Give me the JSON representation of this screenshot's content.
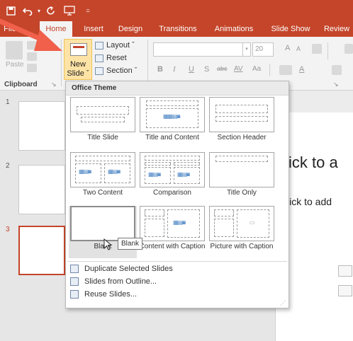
{
  "qat": {
    "save_icon": "save-icon",
    "undo_icon": "undo-icon",
    "redo_icon": "redo-icon",
    "present_icon": "present-icon",
    "more_icon": "qat-more-icon"
  },
  "tabs": [
    {
      "label": "File"
    },
    {
      "label": "Home"
    },
    {
      "label": "Insert"
    },
    {
      "label": "Design"
    },
    {
      "label": "Transitions"
    },
    {
      "label": "Animations"
    },
    {
      "label": "Slide Show"
    },
    {
      "label": "Review"
    }
  ],
  "ribbon": {
    "paste_label": "Paste",
    "clipboard_label": "Clipboard",
    "new_slide_label_1": "New",
    "new_slide_label_2": "Slide ˇ",
    "layout_label": "Layout ˇ",
    "reset_label": "Reset",
    "section_label": "Section ˇ",
    "font_size": "20",
    "bold": "B",
    "italic": "I",
    "underline": "U",
    "strike": "S",
    "abc": "abc",
    "spacing": "AV",
    "case": "Aa",
    "grow": "A",
    "shrink": "A"
  },
  "thumbnails": {
    "numbers": [
      "1",
      "2",
      "3"
    ]
  },
  "slide": {
    "title_text": "ick to a",
    "subtitle_text": "lick to add"
  },
  "dropdown": {
    "header": "Office Theme",
    "layouts": [
      {
        "name": "Title Slide"
      },
      {
        "name": "Title and Content"
      },
      {
        "name": "Section Header"
      },
      {
        "name": "Two Content"
      },
      {
        "name": "Comparison"
      },
      {
        "name": "Title Only"
      },
      {
        "name": "Blank"
      },
      {
        "name": "Content with Caption"
      },
      {
        "name": "Picture with Caption"
      }
    ],
    "menu": [
      {
        "label": "Duplicate Selected Slides"
      },
      {
        "label": "Slides from Outline..."
      },
      {
        "label": "Reuse Slides..."
      }
    ],
    "tooltip": "Blank"
  },
  "colors": {
    "accent": "#c4452a",
    "hover": "#e2e2e2",
    "new_slide_highlight": "#fde3a5",
    "annotation_arrow": "#f0604a"
  }
}
